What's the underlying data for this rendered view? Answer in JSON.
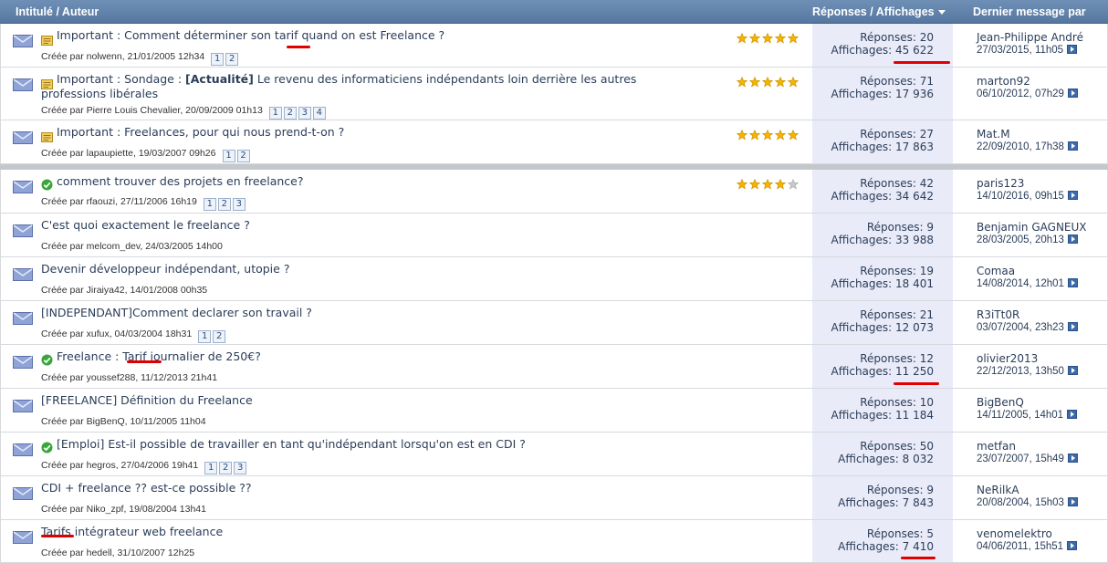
{
  "header": {
    "title_col": "Intitulé / Auteur",
    "stats_col": "Réponses / Affichages",
    "last_col": "Dernier message par"
  },
  "colors": {
    "header_bg": "#5f80a9",
    "stats_bg": "#e9ebf8",
    "star": "#f5b400",
    "check": "#3aa53a",
    "underline": "#e00000"
  },
  "threads": [
    {
      "icon": "important-icon",
      "title_prefix": "Important :",
      "title_tag": "",
      "title": "Comment déterminer son tarif quand on est Freelance ?",
      "author_line": "Créée par nolwenn, 21/01/2005 12h34",
      "pages": [
        "1",
        "2"
      ],
      "stars": 5,
      "replies": "Réponses: 20",
      "views": "Affichages: 45 622",
      "last_user": "Jean-Philippe André",
      "last_date": "27/03/2015, 11h05"
    },
    {
      "icon": "important-icon",
      "title_prefix": "Important :",
      "title_tag": "Sondage : [Actualité]",
      "title": "Le revenu des informaticiens indépendants loin derrière les autres professions libérales",
      "author_line": "Créée par Pierre Louis Chevalier, 20/09/2009 01h13",
      "pages": [
        "1",
        "2",
        "3",
        "4"
      ],
      "stars": 5,
      "replies": "Réponses: 71",
      "views": "Affichages: 17 936",
      "last_user": "marton92",
      "last_date": "06/10/2012, 07h29"
    },
    {
      "icon": "important-icon",
      "title_prefix": "Important :",
      "title_tag": "",
      "title": "Freelances, pour qui nous prend-t-on ?",
      "author_line": "Créée par lapaupiette, 19/03/2007 09h26",
      "pages": [
        "1",
        "2"
      ],
      "stars": 5,
      "replies": "Réponses: 27",
      "views": "Affichages: 17 863",
      "last_user": "Mat.M",
      "last_date": "22/09/2010, 17h38"
    },
    {
      "icon": "resolved-icon",
      "title_prefix": "",
      "title_tag": "",
      "title": "comment trouver des projets en freelance?",
      "author_line": "Créée par rfaouzi, 27/11/2006 16h19",
      "pages": [
        "1",
        "2",
        "3"
      ],
      "stars": 4,
      "replies": "Réponses: 42",
      "views": "Affichages: 34 642",
      "last_user": "paris123",
      "last_date": "14/10/2016, 09h15"
    },
    {
      "icon": "",
      "title_prefix": "",
      "title_tag": "",
      "title": "C'est quoi exactement le freelance ?",
      "author_line": "Créée par melcom_dev, 24/03/2005 14h00",
      "pages": [],
      "stars": 0,
      "replies": "Réponses: 9",
      "views": "Affichages: 33 988",
      "last_user": "Benjamin GAGNEUX",
      "last_date": "28/03/2005, 20h13"
    },
    {
      "icon": "",
      "title_prefix": "",
      "title_tag": "",
      "title": "Devenir développeur indépendant, utopie ?",
      "author_line": "Créée par Jiraiya42, 14/01/2008 00h35",
      "pages": [],
      "stars": 0,
      "replies": "Réponses: 19",
      "views": "Affichages: 18 401",
      "last_user": "Comaa",
      "last_date": "14/08/2014, 12h01"
    },
    {
      "icon": "",
      "title_prefix": "",
      "title_tag": "",
      "title": "[INDEPENDANT]Comment declarer son travail ?",
      "author_line": "Créée par xufux, 04/03/2004 18h31",
      "pages": [
        "1",
        "2"
      ],
      "stars": 0,
      "replies": "Réponses: 21",
      "views": "Affichages: 12 073",
      "last_user": "R3iTt0R",
      "last_date": "03/07/2004, 23h23"
    },
    {
      "icon": "resolved-icon",
      "title_prefix": "",
      "title_tag": "",
      "title": "Freelance : Tarif journalier de 250€?",
      "author_line": "Créée par youssef288, 11/12/2013 21h41",
      "pages": [],
      "stars": 0,
      "replies": "Réponses: 12",
      "views": "Affichages: 11 250",
      "last_user": "olivier2013",
      "last_date": "22/12/2013, 13h50"
    },
    {
      "icon": "",
      "title_prefix": "",
      "title_tag": "",
      "title": "[FREELANCE] Définition du Freelance",
      "author_line": "Créée par BigBenQ, 10/11/2005 11h04",
      "pages": [],
      "stars": 0,
      "replies": "Réponses: 10",
      "views": "Affichages: 11 184",
      "last_user": "BigBenQ",
      "last_date": "14/11/2005, 14h01"
    },
    {
      "icon": "resolved-icon",
      "title_prefix": "",
      "title_tag": "",
      "title": "[Emploi] Est-il possible de travailler en tant qu'indépendant lorsqu'on est en CDI ?",
      "author_line": "Créée par hegros, 27/04/2006 19h41",
      "pages": [
        "1",
        "2",
        "3"
      ],
      "stars": 0,
      "replies": "Réponses: 50",
      "views": "Affichages: 8 032",
      "last_user": "metfan",
      "last_date": "23/07/2007, 15h49"
    },
    {
      "icon": "",
      "title_prefix": "",
      "title_tag": "",
      "title": "CDI + freelance ?? est-ce possible ??",
      "author_line": "Créée par Niko_zpf, 19/08/2004 13h41",
      "pages": [],
      "stars": 0,
      "replies": "Réponses: 9",
      "views": "Affichages: 7 843",
      "last_user": "NeRilkA",
      "last_date": "20/08/2004, 15h03"
    },
    {
      "icon": "",
      "title_prefix": "",
      "title_tag": "",
      "title": "Tarifs intégrateur web freelance",
      "author_line": "Créée par hedell, 31/10/2007 12h25",
      "pages": [],
      "stars": 0,
      "replies": "Réponses: 5",
      "views": "Affichages: 7 410",
      "last_user": "venomelektro",
      "last_date": "04/06/2011, 15h51"
    }
  ]
}
